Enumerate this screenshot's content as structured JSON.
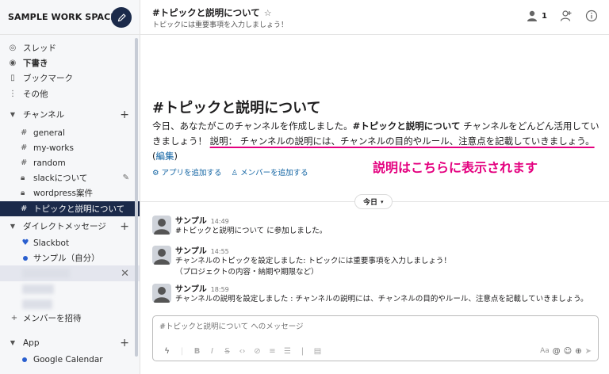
{
  "workspace": {
    "name": "SAMPLE WORK SPACE"
  },
  "sidebar": {
    "nav": [
      {
        "label": "スレッド",
        "icon": "threads-icon"
      },
      {
        "label": "下書き",
        "icon": "drafts-icon"
      },
      {
        "label": "ブックマーク",
        "icon": "bookmark-icon"
      },
      {
        "label": "その他",
        "icon": "more-icon"
      }
    ],
    "channels_label": "チャンネル",
    "channels": [
      {
        "label": "general"
      },
      {
        "label": "my-works"
      },
      {
        "label": "random"
      },
      {
        "label": "slackについて"
      },
      {
        "label": "wordpress案件"
      },
      {
        "label": "トピックと説明について"
      }
    ],
    "dm_label": "ダイレクトメッセージ",
    "dms": [
      {
        "label": "Slackbot"
      },
      {
        "label": "サンプル（自分）"
      }
    ],
    "invite_label": "メンバーを招待",
    "app_label": "App",
    "apps": [
      {
        "label": "Google Calendar"
      }
    ]
  },
  "header": {
    "title": "#トピックと説明について",
    "topic": "トピックには重要事項を入力しましょう！",
    "member_count": "1"
  },
  "intro": {
    "title": "#トピックと説明について",
    "text_1": "今日、あなたがこのチャンネルを作成しました。",
    "channel_bold": "#トピックと説明について",
    "text_2": " チャンネルをどんどん活用していきましょう！ ",
    "description": "説明： チャンネルの説明には、チャンネルの目的やルール、注意点を記載していきましょう。",
    "edit_label": "編集",
    "add_app": "アプリを追加する",
    "add_member": "メンバーを追加する"
  },
  "annotation": "説明はこちらに表示されます",
  "date_divider": "今日",
  "messages": [
    {
      "author": "サンプル",
      "time": "14:49",
      "lines": [
        "#トピックと説明について に参加しました。"
      ]
    },
    {
      "author": "サンプル",
      "time": "14:55",
      "lines": [
        "チャンネルのトピックを設定しました: トピックには重要事項を入力しましょう！",
        "（プロジェクトの内容・納期や期限など）"
      ]
    },
    {
      "author": "サンプル",
      "time": "18:59",
      "lines": [
        "チャンネルの説明を設定しました : チャンネルの説明には、チャンネルの目的やルール、注意点を記載していきましょう。"
      ]
    }
  ],
  "composer": {
    "placeholder": "#トピックと説明について へのメッセージ",
    "aa_label": "Aa"
  },
  "colors": {
    "active": "#1b2a4a",
    "accent": "#e4007f",
    "link": "#1264a3"
  }
}
